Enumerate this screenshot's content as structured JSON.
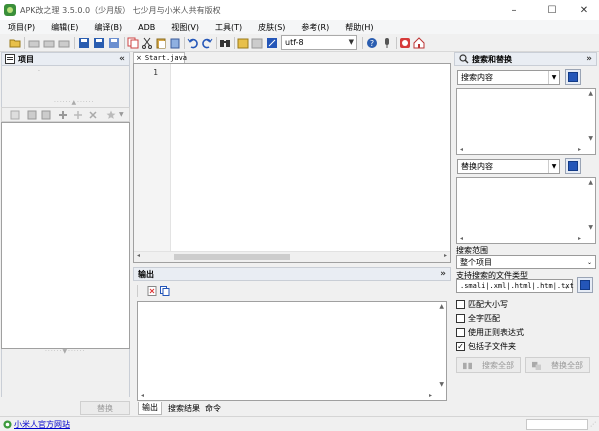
{
  "window": {
    "title": "APK改之理 3.5.0.0（少月版） 七少月与小米人共有版权",
    "min_glyph": "–",
    "max_glyph": "☐",
    "close_glyph": "✕"
  },
  "menu": [
    "项目(P)",
    "编辑(E)",
    "编译(B)",
    "ADB",
    "视图(V)",
    "工具(T)",
    "皮肤(S)",
    "参考(R)",
    "帮助(H)"
  ],
  "toolbar": {
    "encoding": "utf-8"
  },
  "project_panel": {
    "title": "项目",
    "collapse_glyph": "«",
    "replace_button": "替换"
  },
  "editor": {
    "tab_close": "×",
    "tab_label": "Start.java",
    "line_number": "1"
  },
  "output_panel": {
    "title": "输出",
    "expand_glyph": "»",
    "tabs": [
      "输出",
      "搜索结果",
      "命令"
    ]
  },
  "search_panel": {
    "title": "搜索和替换",
    "collapse_glyph": "»",
    "search_placeholder": "搜索内容",
    "replace_placeholder": "替换内容",
    "scope_label": "搜索范围",
    "scope_value": "整个项目",
    "filetypes_label": "支持搜索的文件类型",
    "filetypes_value": ".smali|.xml|.html|.htm|.txt",
    "options": [
      {
        "label": "匹配大小写",
        "checked": false
      },
      {
        "label": "全字匹配",
        "checked": false
      },
      {
        "label": "使用正则表达式",
        "checked": false
      },
      {
        "label": "包括子文件夹",
        "checked": true
      }
    ],
    "search_all": "搜索全部",
    "replace_all": "替换全部"
  },
  "statusbar": {
    "link": "小米人官方网站"
  },
  "colors": {
    "accent": "#2456b8",
    "link": "#0000cc",
    "panel_header": "#e9edf3"
  }
}
